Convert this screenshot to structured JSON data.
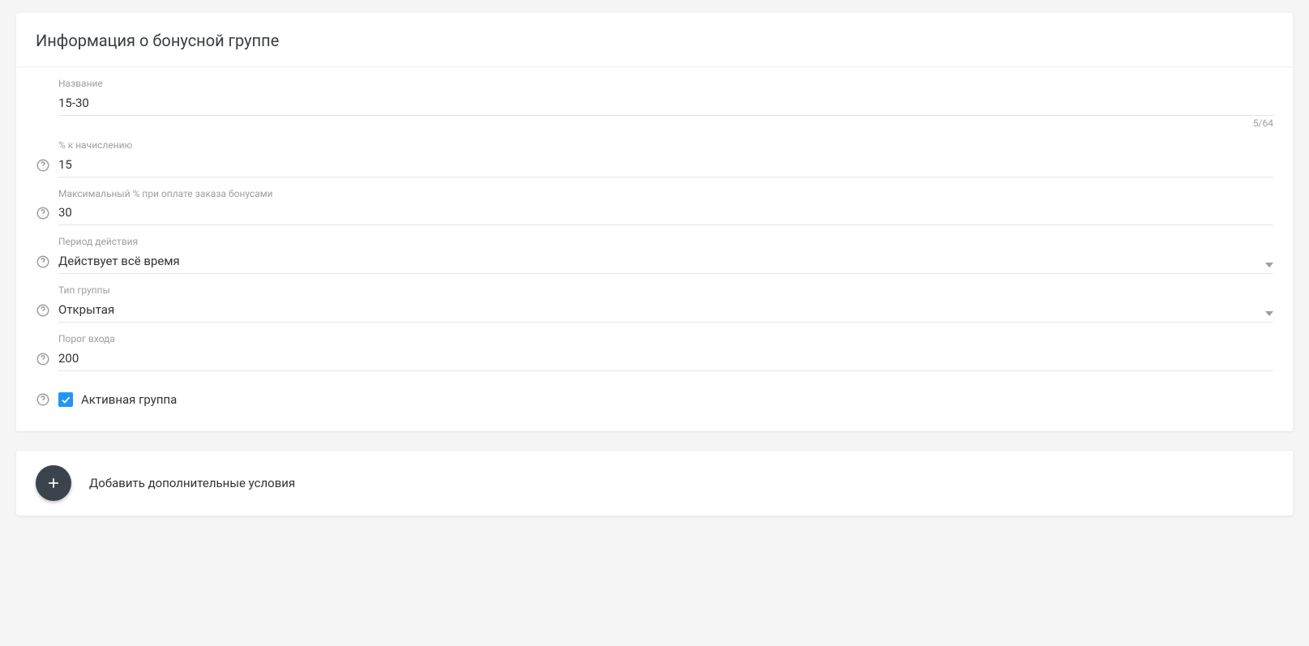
{
  "card": {
    "title": "Информация о бонусной группе"
  },
  "fields": {
    "name": {
      "label": "Название",
      "value": "15-30",
      "counter": "5/64"
    },
    "percent": {
      "label": "% к начислению",
      "value": "15"
    },
    "maxPercent": {
      "label": "Максимальный % при оплате заказа бонусами",
      "value": "30"
    },
    "period": {
      "label": "Период действия",
      "value": "Действует всё время"
    },
    "groupType": {
      "label": "Тип группы",
      "value": "Открытая"
    },
    "threshold": {
      "label": "Порог входа",
      "value": "200"
    },
    "active": {
      "label": "Активная группа",
      "checked": true
    }
  },
  "addConditions": {
    "label": "Добавить дополнительные условия"
  }
}
